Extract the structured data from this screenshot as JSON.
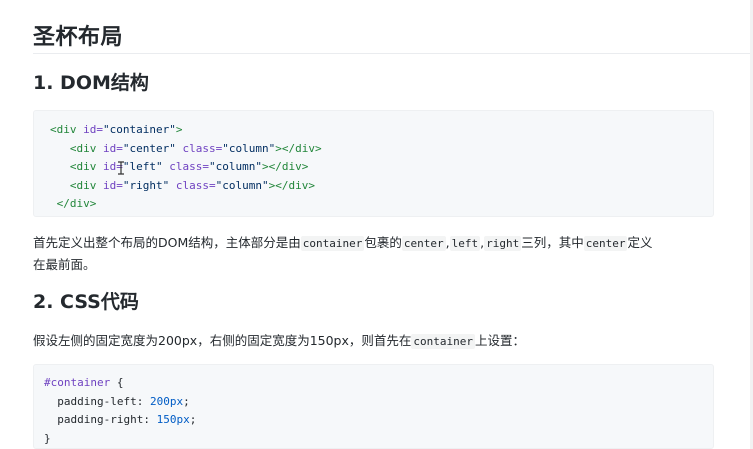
{
  "title": "圣杯布局",
  "section1": {
    "heading": "1. DOM结构",
    "code": {
      "line1": {
        "open": "<div",
        "attr": " id=",
        "val": "\"container\"",
        "close": ">"
      },
      "line2": {
        "open": "<div",
        "attr1": " id=",
        "val1": "\"center\"",
        "attr2": " class=",
        "val2": "\"column\"",
        "close": "></div>"
      },
      "line3": {
        "open": "<div",
        "attr1": " id=",
        "val1": "\"left\"",
        "attr2": " class=",
        "val2": "\"column\"",
        "close": "></div>"
      },
      "line4": {
        "open": "<div",
        "attr1": " id=",
        "val1": "\"right\"",
        "attr2": " class=",
        "val2": "\"column\"",
        "close": "></div>"
      },
      "line5": "</div>"
    },
    "paragraph": {
      "t1": "首先定义出整个布局的DOM结构，主体部分是由",
      "c1": "container",
      "t2": "包裹的",
      "c2": "center",
      "t3": ",",
      "c3": "left",
      "t4": ",",
      "c4": "right",
      "t5": "三列，其中",
      "c5": "center",
      "t6": "定义",
      "t7": "在最前面。"
    }
  },
  "section2": {
    "heading": "2. CSS代码",
    "paragraph": {
      "t1": "假设左侧的固定宽度为200px，右侧的固定宽度为150px，则首先在",
      "c1": "container",
      "t2": "上设置："
    },
    "code": {
      "selector": "#container",
      "brace_open": " {",
      "p1_name": "padding-left: ",
      "p1_val": "200px",
      "p2_name": "padding-right: ",
      "p2_val": "150px",
      "semi": ";",
      "brace_close": "}"
    }
  }
}
